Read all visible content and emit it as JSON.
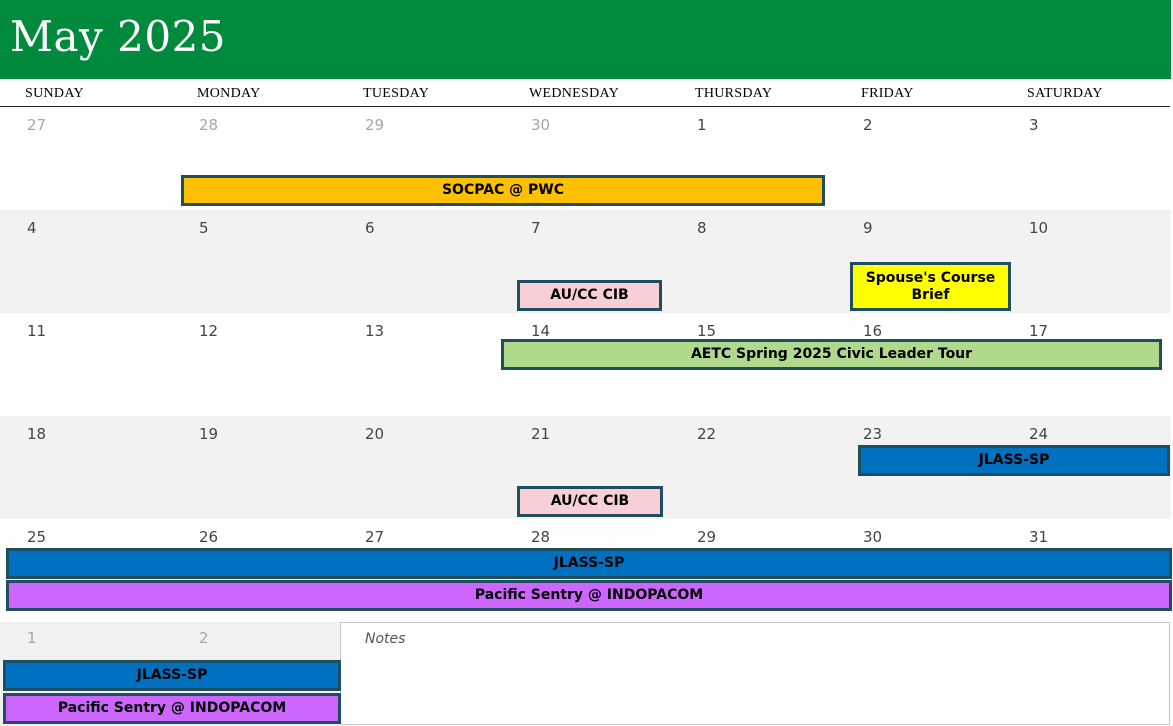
{
  "header": {
    "title": "May 2025",
    "color": "#008a3e"
  },
  "weekdays": [
    "SUNDAY",
    "MONDAY",
    "TUESDAY",
    "WEDNESDAY",
    "THURSDAY",
    "FRIDAY",
    "SATURDAY"
  ],
  "weeks": [
    [
      "27",
      "28",
      "29",
      "30",
      "1",
      "2",
      "3"
    ],
    [
      "4",
      "5",
      "6",
      "7",
      "8",
      "9",
      "10"
    ],
    [
      "11",
      "12",
      "13",
      "14",
      "15",
      "16",
      "17"
    ],
    [
      "18",
      "19",
      "20",
      "21",
      "22",
      "23",
      "24"
    ],
    [
      "25",
      "26",
      "27",
      "28",
      "29",
      "30",
      "31"
    ]
  ],
  "next_month_days": [
    "1",
    "2"
  ],
  "events": {
    "socpac": {
      "label": "SOCPAC @ PWC",
      "color": "#ffc000"
    },
    "aucc_1": {
      "label": "AU/CC CIB",
      "color": "#f8cfd6"
    },
    "spouse": {
      "label": "Spouse's Course Brief",
      "color": "#ffff00"
    },
    "aetc": {
      "label": "AETC Spring 2025 Civic Leader Tour",
      "color": "#b1d98e"
    },
    "jlass_1": {
      "label": "JLASS-SP",
      "color": "#0070c0"
    },
    "aucc_2": {
      "label": "AU/CC CIB",
      "color": "#f8cfd6"
    },
    "jlass_2": {
      "label": "JLASS-SP",
      "color": "#0070c0"
    },
    "pacific_1": {
      "label": "Pacific Sentry @ INDOPACOM",
      "color": "#cc66ff"
    },
    "jlass_3": {
      "label": "JLASS-SP",
      "color": "#0070c0"
    },
    "pacific_2": {
      "label": "Pacific Sentry @ INDOPACOM",
      "color": "#cc66ff"
    }
  },
  "notes": {
    "label": "Notes"
  }
}
